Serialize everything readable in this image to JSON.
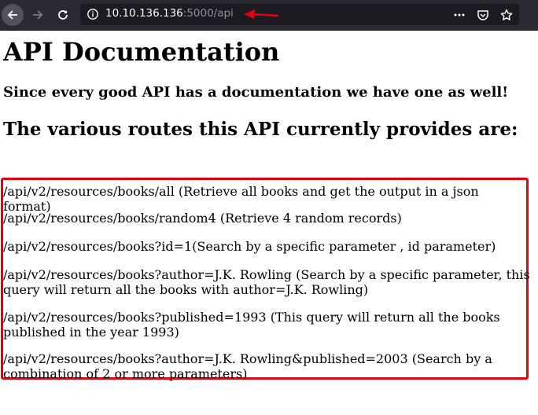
{
  "browser": {
    "url_host": "10.10.136.136",
    "url_rest": ":5000/api",
    "icons": {
      "back": "back-arrow-icon",
      "forward": "forward-arrow-icon",
      "reload": "reload-icon",
      "info": "info-icon",
      "annotation": "red-arrow-annotation",
      "more": "more-dots-icon",
      "pocket": "pocket-icon",
      "bookmark": "star-icon"
    },
    "annotation_color": "#e3000f"
  },
  "page": {
    "title": "API Documentation",
    "subtitle": "Since every good API has a documentation we have one as well!",
    "routes_heading": "The various routes this API currently provides are:",
    "routes": [
      "/api/v2/resources/books/all (Retrieve all books and get the output in a json format)",
      "/api/v2/resources/books/random4 (Retrieve 4 random records)",
      "/api/v2/resources/books?id=1(Search by a specific parameter , id parameter)",
      "/api/v2/resources/books?author=J.K. Rowling (Search by a specific parameter, this query will return all the books with author=J.K. Rowling)",
      "/api/v2/resources/books?published=1993 (This query will return all the books published in the year 1993)",
      "/api/v2/resources/books?author=J.K. Rowling&published=2003 (Search by a combination of 2 or more parameters)"
    ]
  }
}
